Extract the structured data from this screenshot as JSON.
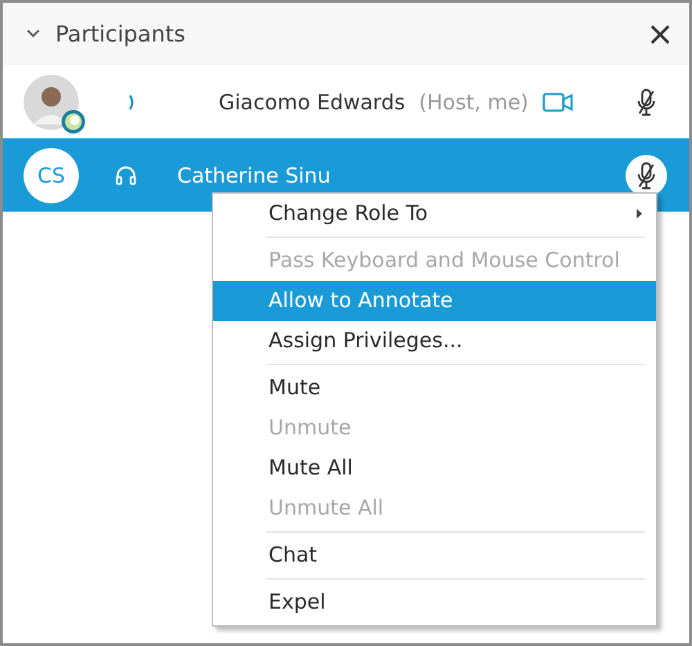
{
  "panel": {
    "title": "Participants"
  },
  "participants": [
    {
      "name": "Giacomo Edwards",
      "role": "(Host, me)",
      "avatar": {
        "kind": "photo"
      },
      "audio": {
        "kind": "signal"
      },
      "video": true,
      "muted": true,
      "selected": false
    },
    {
      "name": "Catherine Sinu",
      "avatar": {
        "kind": "initials",
        "initials": "CS"
      },
      "audio": {
        "kind": "headset"
      },
      "video": false,
      "muted": true,
      "selected": true
    }
  ],
  "context_menu": {
    "items": [
      {
        "label": "Change Role To",
        "submenu": true,
        "disabled": false,
        "selected": false,
        "separator_after": true
      },
      {
        "label": "Pass Keyboard and Mouse Control",
        "submenu": false,
        "disabled": true,
        "selected": false,
        "separator_after": false
      },
      {
        "label": "Allow to Annotate",
        "submenu": false,
        "disabled": false,
        "selected": true,
        "separator_after": false
      },
      {
        "label": "Assign Privileges...",
        "submenu": false,
        "disabled": false,
        "selected": false,
        "separator_after": true
      },
      {
        "label": "Mute",
        "submenu": false,
        "disabled": false,
        "selected": false,
        "separator_after": false
      },
      {
        "label": "Unmute",
        "submenu": false,
        "disabled": true,
        "selected": false,
        "separator_after": false
      },
      {
        "label": "Mute All",
        "submenu": false,
        "disabled": false,
        "selected": false,
        "separator_after": false
      },
      {
        "label": "Unmute All",
        "submenu": false,
        "disabled": true,
        "selected": false,
        "separator_after": true
      },
      {
        "label": "Chat",
        "submenu": false,
        "disabled": false,
        "selected": false,
        "separator_after": true
      },
      {
        "label": "Expel",
        "submenu": false,
        "disabled": false,
        "selected": false,
        "separator_after": false
      }
    ]
  }
}
